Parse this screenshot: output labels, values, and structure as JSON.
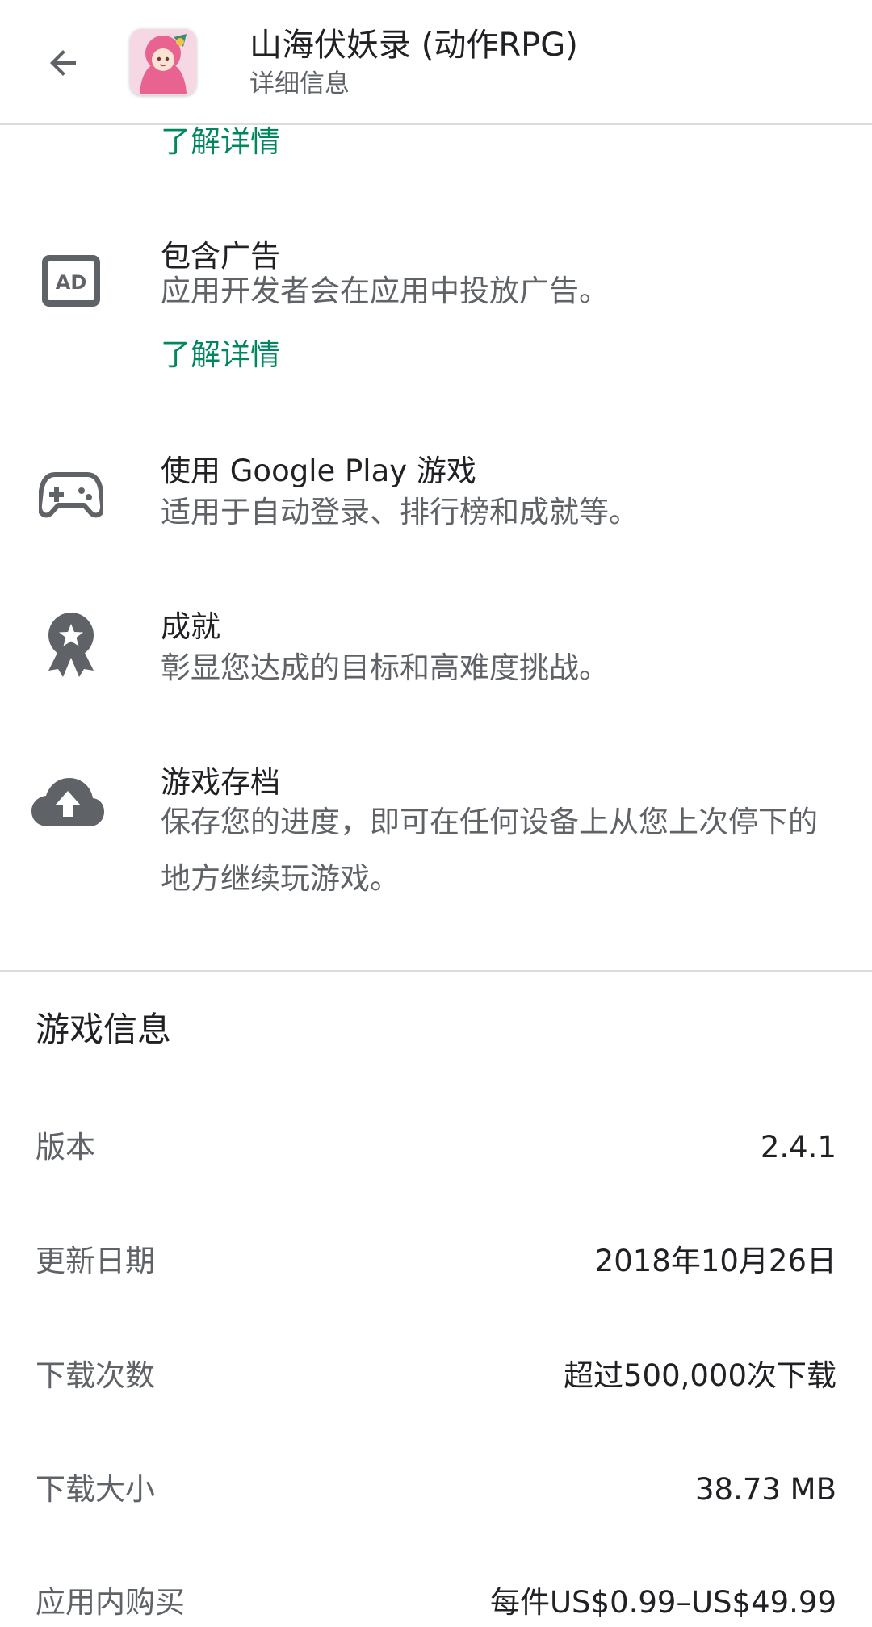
{
  "header": {
    "back_icon": "arrow-back-icon",
    "app_icon": "game-app-icon",
    "title": "山海伏妖录 (动作RPG)",
    "subtitle": "详细信息"
  },
  "top_link": "了解详情",
  "features": [
    {
      "icon": "ad-icon",
      "title": "包含广告",
      "description": "应用开发者会在应用中投放广告。",
      "link": "了解详情"
    },
    {
      "icon": "gamepad-icon",
      "title": "使用 Google Play 游戏",
      "description": "适用于自动登录、排行榜和成就等。"
    },
    {
      "icon": "achievement-icon",
      "title": "成就",
      "description": "彰显您达成的目标和高难度挑战。"
    },
    {
      "icon": "cloud-upload-icon",
      "title": "游戏存档",
      "description": "保存您的进度，即可在任何设备上从您上次停下的地方继续玩游戏。"
    }
  ],
  "game_info": {
    "title": "游戏信息",
    "rows": [
      {
        "label": "版本",
        "value": "2.4.1"
      },
      {
        "label": "更新日期",
        "value": "2018年10月26日"
      },
      {
        "label": "下载次数",
        "value": "超过500,000次下载"
      },
      {
        "label": "下载大小",
        "value": "38.73 MB"
      },
      {
        "label": "应用内购买",
        "value": "每件US$0.99–US$49.99"
      }
    ]
  },
  "colors": {
    "accent_green": "#01875f",
    "icon_gray": "#5f6368",
    "text_primary": "#202124",
    "text_secondary": "#5f6368",
    "divider": "#dadce0"
  }
}
